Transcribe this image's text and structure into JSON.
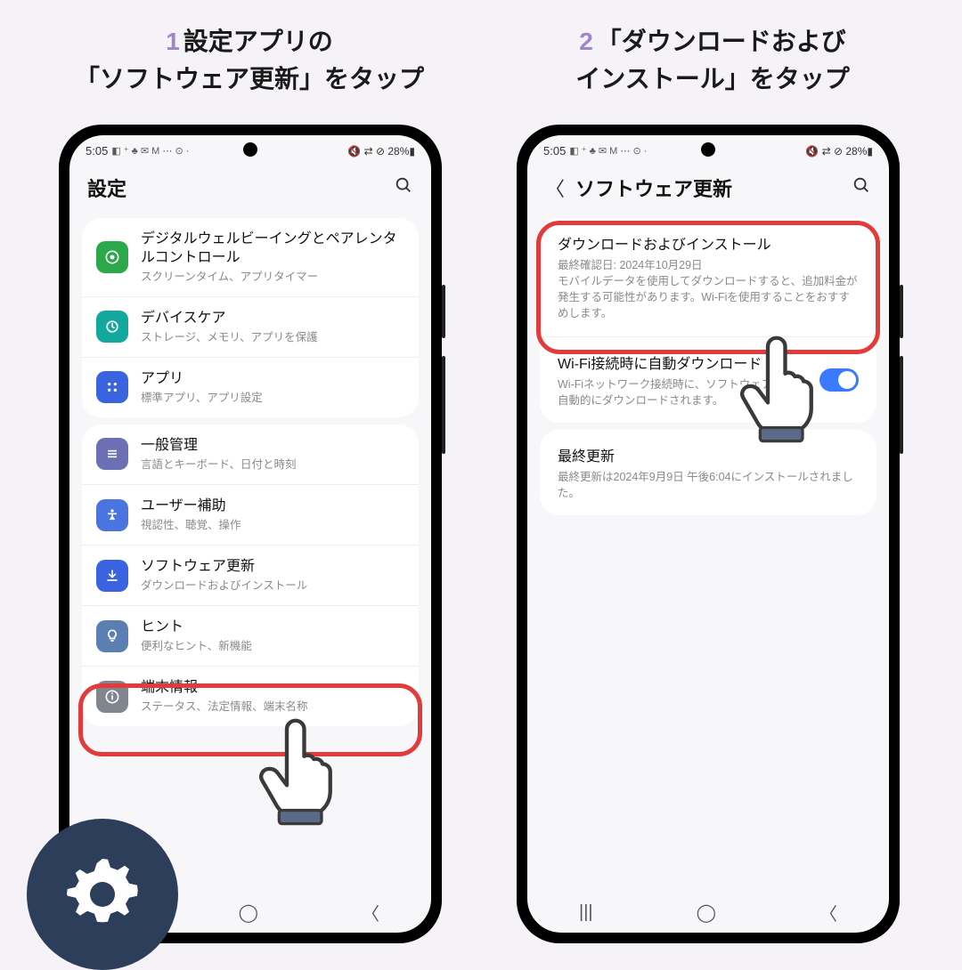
{
  "headings": {
    "n1": "1",
    "t1a": "設定アプリの",
    "t1b": "「ソフトウェア更新」をタップ",
    "n2": "2",
    "t2a": "「ダウンロードおよび",
    "t2b": "インストール」をタップ"
  },
  "status": {
    "time": "5:05",
    "icons_left": "◧ ⁺ ♣ ✉ M ⋯ ⊙ ·",
    "right": "🔇 ⇄ ⊘ 28%▮"
  },
  "phone1": {
    "header": {
      "title": "設定"
    },
    "group1": [
      {
        "icon_color": "#2aa84a",
        "icon": "wellbeing",
        "title": "デジタルウェルビーイングとペアレンタルコントロール",
        "sub": "スクリーンタイム、アプリタイマー"
      },
      {
        "icon_color": "#13a89e",
        "icon": "care",
        "title": "デバイスケア",
        "sub": "ストレージ、メモリ、アプリを保護"
      },
      {
        "icon_color": "#3a63e0",
        "icon": "apps",
        "title": "アプリ",
        "sub": "標準アプリ、アプリ設定"
      }
    ],
    "group2": [
      {
        "icon_color": "#6b6fb3",
        "icon": "general",
        "title": "一般管理",
        "sub": "言語とキーボード、日付と時刻"
      },
      {
        "icon_color": "#4a74e0",
        "icon": "a11y",
        "title": "ユーザー補助",
        "sub": "視認性、聴覚、操作"
      },
      {
        "icon_color": "#3a63e0",
        "icon": "update",
        "title": "ソフトウェア更新",
        "sub": "ダウンロードおよびインストール"
      },
      {
        "icon_color": "#5c7fb3",
        "icon": "hint",
        "title": "ヒント",
        "sub": "便利なヒント、新機能"
      },
      {
        "icon_color": "#808590",
        "icon": "info",
        "title": "端末情報",
        "sub": "ステータス、法定情報、端末名称"
      }
    ]
  },
  "phone2": {
    "header": {
      "title": "ソフトウェア更新"
    },
    "items": [
      {
        "title": "ダウンロードおよびインストール",
        "sub": "最終確認日: 2024年10月29日\nモバイルデータを使用してダウンロードすると、追加料金が発生する可能性があります。Wi-Fiを使用することをおすすめします。"
      },
      {
        "title": "Wi-Fi接続時に自動ダウンロード",
        "sub": "Wi-Fiネットワーク接続時に、ソフトウェア更新が自動的にダウンロードされます。",
        "toggle": true
      },
      {
        "title": "最終更新",
        "sub": "最終更新は2024年9月9日 午後6:04にインストールされました。"
      }
    ]
  },
  "nav": {
    "recent": "|||",
    "home": "◯",
    "back": "〈"
  }
}
